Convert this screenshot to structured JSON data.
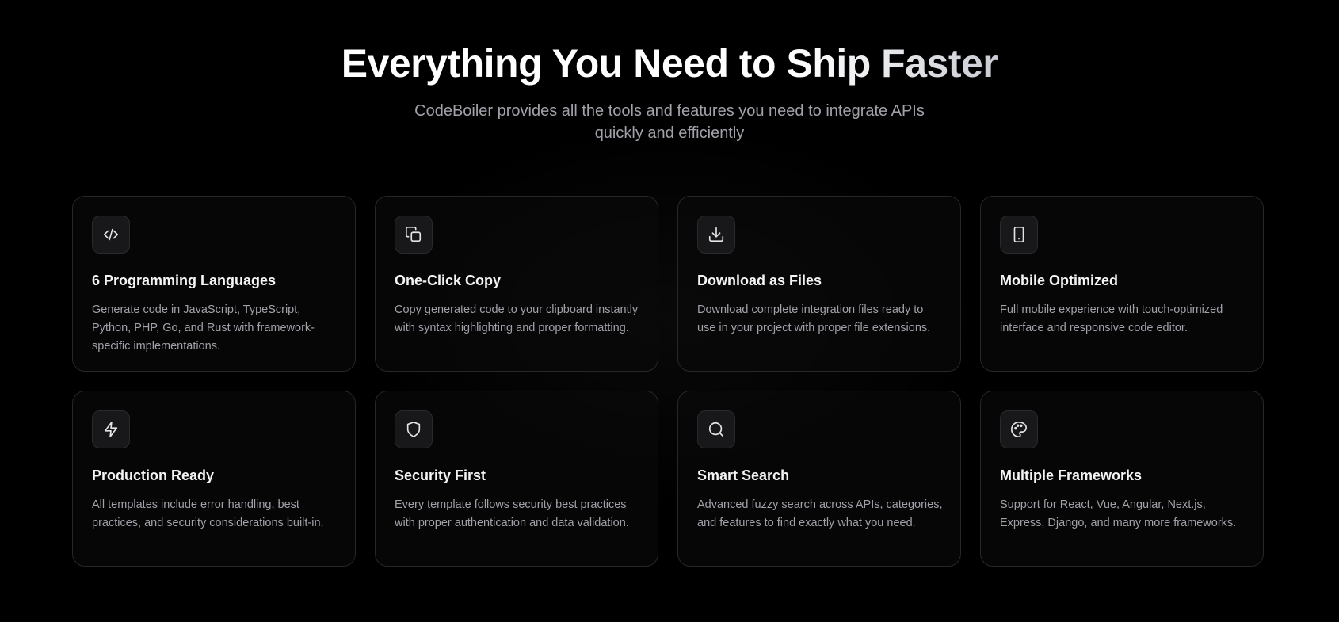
{
  "hero": {
    "title": "Everything You Need to Ship Faster",
    "subtitle": "CodeBoiler provides all the tools and features you need to integrate APIs quickly and efficiently"
  },
  "features": [
    {
      "icon": "code-icon",
      "title": "6 Programming Languages",
      "description": "Generate code in JavaScript, TypeScript, Python, PHP, Go, and Rust with framework-specific implementations."
    },
    {
      "icon": "copy-icon",
      "title": "One-Click Copy",
      "description": "Copy generated code to your clipboard instantly with syntax highlighting and proper formatting."
    },
    {
      "icon": "download-icon",
      "title": "Download as Files",
      "description": "Download complete integration files ready to use in your project with proper file extensions."
    },
    {
      "icon": "smartphone-icon",
      "title": "Mobile Optimized",
      "description": "Full mobile experience with touch-optimized interface and responsive code editor."
    },
    {
      "icon": "zap-icon",
      "title": "Production Ready",
      "description": "All templates include error handling, best practices, and security considerations built-in."
    },
    {
      "icon": "shield-icon",
      "title": "Security First",
      "description": "Every template follows security best practices with proper authentication and data validation."
    },
    {
      "icon": "search-icon",
      "title": "Smart Search",
      "description": "Advanced fuzzy search across APIs, categories, and features to find exactly what you need."
    },
    {
      "icon": "palette-icon",
      "title": "Multiple Frameworks",
      "description": "Support for React, Vue, Angular, Next.js, Express, Django, and many more frameworks."
    }
  ],
  "colors": {
    "background": "#000000",
    "card_border": "#27272a",
    "muted_text": "#a1a1aa",
    "icon_box": "#18181b"
  }
}
